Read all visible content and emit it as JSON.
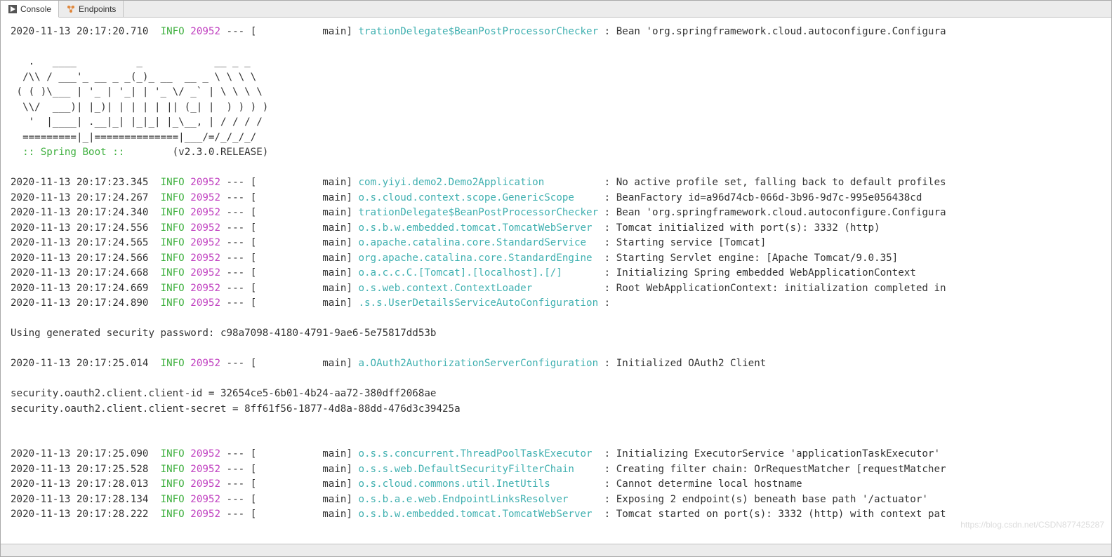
{
  "tabs": [
    {
      "label": "Console",
      "active": true,
      "icon": "play-icon"
    },
    {
      "label": "Endpoints",
      "active": false,
      "icon": "endpoints-icon"
    }
  ],
  "colors": {
    "info": "#40b040",
    "pid": "#c040c0",
    "logger": "#40b0b0"
  },
  "banner": {
    "art": [
      "   .   ____          _            __ _ _",
      "  /\\\\ / ___'_ __ _ _(_)_ __  __ _ \\ \\ \\ \\",
      " ( ( )\\___ | '_ | '_| | '_ \\/ _` | \\ \\ \\ \\",
      "  \\\\/  ___)| |_)| | | | | || (_| |  ) ) ) )",
      "   '  |____| .__|_| |_|_| |_\\__, | / / / /",
      "  =========|_|==============|___/=/_/_/_/"
    ],
    "boot_line": "  :: Spring Boot ::        (v2.3.0.RELEASE)",
    "boot_prefix": "  :: Spring Boot :: ",
    "boot_version": "       (v2.3.0.RELEASE)"
  },
  "password_line": "Using generated security password: c98a7098-4180-4791-9ae6-5e75817dd53b",
  "oauth_lines": [
    "security.oauth2.client.client-id = 32654ce5-6b01-4b24-aa72-380dff2068ae",
    "security.oauth2.client.client-secret = 8ff61f56-1877-4d8a-88dd-476d3c39425a"
  ],
  "log_entries_top": [
    {
      "ts": "2020-11-13 20:17:20.710",
      "level": "INFO",
      "pid": "20952",
      "thread": "main",
      "logger": "trationDelegate$BeanPostProcessorChecker",
      "msg": "Bean 'org.springframework.cloud.autoconfigure.Configura"
    }
  ],
  "log_entries_mid": [
    {
      "ts": "2020-11-13 20:17:23.345",
      "level": "INFO",
      "pid": "20952",
      "thread": "main",
      "logger": "com.yiyi.demo2.Demo2Application",
      "msg": "No active profile set, falling back to default profiles"
    },
    {
      "ts": "2020-11-13 20:17:24.267",
      "level": "INFO",
      "pid": "20952",
      "thread": "main",
      "logger": "o.s.cloud.context.scope.GenericScope",
      "msg": "BeanFactory id=a96d74cb-066d-3b96-9d7c-995e056438cd"
    },
    {
      "ts": "2020-11-13 20:17:24.340",
      "level": "INFO",
      "pid": "20952",
      "thread": "main",
      "logger": "trationDelegate$BeanPostProcessorChecker",
      "msg": "Bean 'org.springframework.cloud.autoconfigure.Configura"
    },
    {
      "ts": "2020-11-13 20:17:24.556",
      "level": "INFO",
      "pid": "20952",
      "thread": "main",
      "logger": "o.s.b.w.embedded.tomcat.TomcatWebServer",
      "msg": "Tomcat initialized with port(s): 3332 (http)"
    },
    {
      "ts": "2020-11-13 20:17:24.565",
      "level": "INFO",
      "pid": "20952",
      "thread": "main",
      "logger": "o.apache.catalina.core.StandardService",
      "msg": "Starting service [Tomcat]"
    },
    {
      "ts": "2020-11-13 20:17:24.566",
      "level": "INFO",
      "pid": "20952",
      "thread": "main",
      "logger": "org.apache.catalina.core.StandardEngine",
      "msg": "Starting Servlet engine: [Apache Tomcat/9.0.35]"
    },
    {
      "ts": "2020-11-13 20:17:24.668",
      "level": "INFO",
      "pid": "20952",
      "thread": "main",
      "logger": "o.a.c.c.C.[Tomcat].[localhost].[/]",
      "msg": "Initializing Spring embedded WebApplicationContext"
    },
    {
      "ts": "2020-11-13 20:17:24.669",
      "level": "INFO",
      "pid": "20952",
      "thread": "main",
      "logger": "o.s.web.context.ContextLoader",
      "msg": "Root WebApplicationContext: initialization completed in"
    },
    {
      "ts": "2020-11-13 20:17:24.890",
      "level": "INFO",
      "pid": "20952",
      "thread": "main",
      "logger": ".s.s.UserDetailsServiceAutoConfiguration",
      "msg": ""
    }
  ],
  "log_entries_oauth": [
    {
      "ts": "2020-11-13 20:17:25.014",
      "level": "INFO",
      "pid": "20952",
      "thread": "main",
      "logger": "a.OAuth2AuthorizationServerConfiguration",
      "msg": "Initialized OAuth2 Client"
    }
  ],
  "log_entries_tail": [
    {
      "ts": "2020-11-13 20:17:25.090",
      "level": "INFO",
      "pid": "20952",
      "thread": "main",
      "logger": "o.s.s.concurrent.ThreadPoolTaskExecutor",
      "msg": "Initializing ExecutorService 'applicationTaskExecutor'"
    },
    {
      "ts": "2020-11-13 20:17:25.528",
      "level": "INFO",
      "pid": "20952",
      "thread": "main",
      "logger": "o.s.s.web.DefaultSecurityFilterChain",
      "msg": "Creating filter chain: OrRequestMatcher [requestMatcher"
    },
    {
      "ts": "2020-11-13 20:17:28.013",
      "level": "INFO",
      "pid": "20952",
      "thread": "main",
      "logger": "o.s.cloud.commons.util.InetUtils",
      "msg": "Cannot determine local hostname"
    },
    {
      "ts": "2020-11-13 20:17:28.134",
      "level": "INFO",
      "pid": "20952",
      "thread": "main",
      "logger": "o.s.b.a.e.web.EndpointLinksResolver",
      "msg": "Exposing 2 endpoint(s) beneath base path '/actuator'"
    },
    {
      "ts": "2020-11-13 20:17:28.222",
      "level": "INFO",
      "pid": "20952",
      "thread": "main",
      "logger": "o.s.b.w.embedded.tomcat.TomcatWebServer",
      "msg": "Tomcat started on port(s): 3332 (http) with context pat"
    }
  ],
  "watermark": "https://blog.csdn.net/CSDN877425287"
}
